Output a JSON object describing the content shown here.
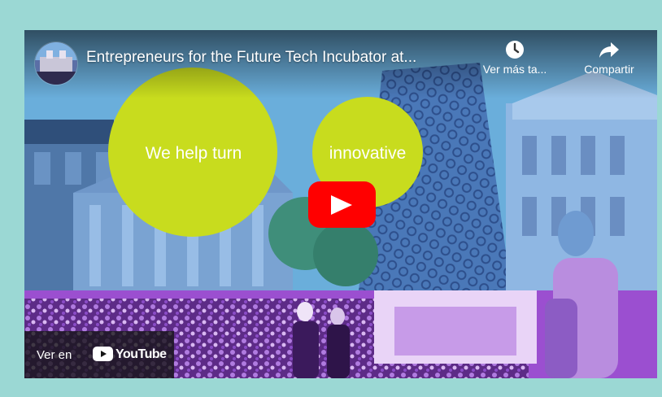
{
  "video": {
    "title": "Entrepreneurs for the Future Tech Incubator at...",
    "circle_left_text": "We help turn",
    "circle_right_text": "innovative"
  },
  "actions": {
    "watch_later_label": "Ver más ta...",
    "share_label": "Compartir"
  },
  "watch_on": {
    "label": "Ver en",
    "brand": "YouTube"
  },
  "icons": {
    "channel": "channel-avatar-icon",
    "watch_later": "clock-icon",
    "share": "share-arrow-icon",
    "play": "play-icon",
    "youtube": "youtube-logo-icon"
  },
  "colors": {
    "page_background": "#9bd8d4",
    "circle": "#c8dc1e",
    "play_button": "#ff0000",
    "overlay_purple": "#9b4fd0",
    "overlay_blue": "#5ea3cf"
  }
}
